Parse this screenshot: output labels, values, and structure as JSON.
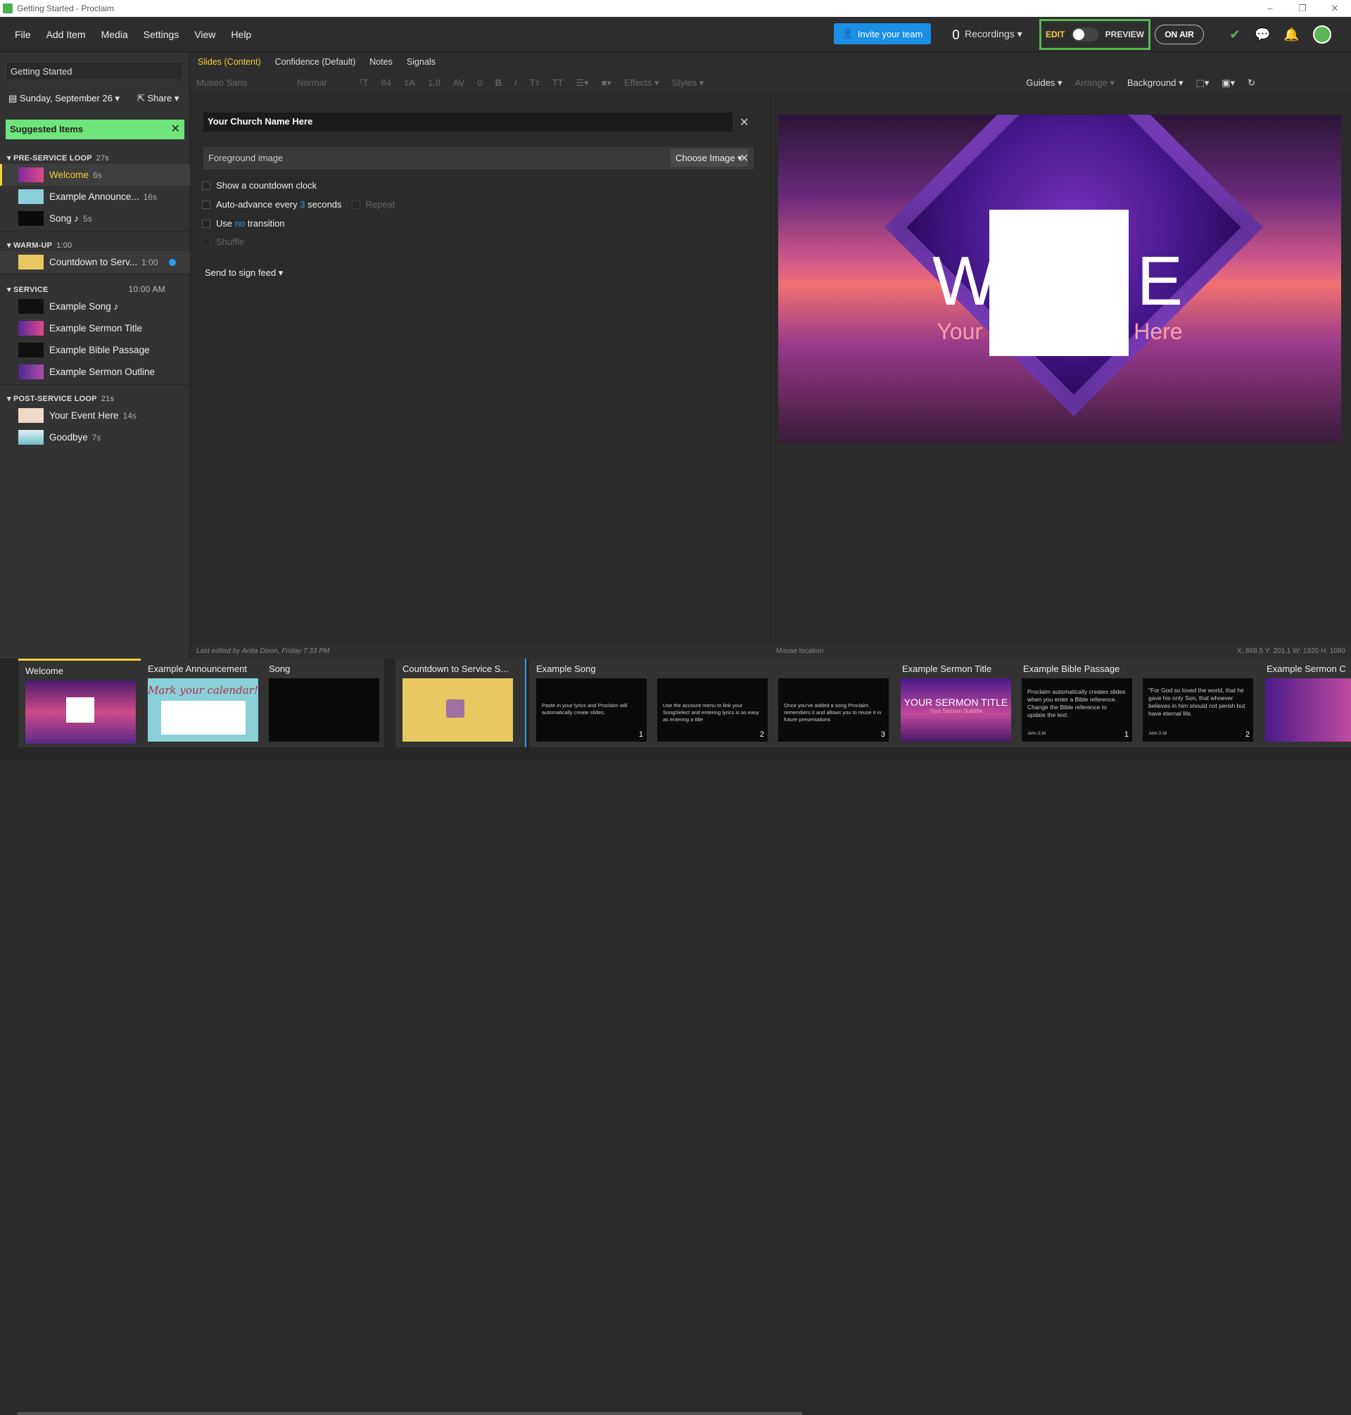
{
  "window": {
    "title": "Getting Started - Proclaim",
    "controls": [
      "–",
      "❐",
      "✕"
    ]
  },
  "menu": [
    "File",
    "Add Item",
    "Media",
    "Settings",
    "View",
    "Help"
  ],
  "topbar": {
    "invite": "Invite your team",
    "recordings": "Recordings ▾",
    "edit": "EDIT",
    "preview": "PREVIEW",
    "on_air": "ON AIR",
    "accent": "#5ab552"
  },
  "sidebar": {
    "title": "Getting Started",
    "date": "Sunday, September 26 ▾",
    "share": "Share ▾",
    "suggested": "Suggested Items",
    "sections": {
      "pre": {
        "name": "PRE-SERVICE LOOP",
        "time": "27s"
      },
      "warm": {
        "name": "WARM-UP",
        "time": "1:00"
      },
      "service": {
        "name": "SERVICE",
        "time": "10:00 AM"
      },
      "post": {
        "name": "POST-SERVICE LOOP",
        "time": "21s"
      }
    },
    "items": [
      {
        "label": "Welcome",
        "dur": "6s"
      },
      {
        "label": "Example Announce...",
        "dur": "16s"
      },
      {
        "label": "Song ♪",
        "dur": "5s"
      },
      {
        "label": "Countdown to Serv...",
        "dur": "1:00"
      },
      {
        "label": "Example Song ♪",
        "dur": ""
      },
      {
        "label": "Example Sermon Title",
        "dur": ""
      },
      {
        "label": "Example Bible Passage",
        "dur": ""
      },
      {
        "label": "Example Sermon Outline",
        "dur": ""
      },
      {
        "label": "Your Event Here",
        "dur": "14s"
      },
      {
        "label": "Goodbye",
        "dur": "7s"
      }
    ]
  },
  "tabs": [
    "Slides (Content)",
    "Confidence (Default)",
    "Notes",
    "Signals"
  ],
  "format": {
    "font": "Museo Sans",
    "weight": "Normal",
    "size": "84",
    "line": "1.0",
    "spacing": "0",
    "effects": "Effects ▾",
    "styles": "Styles ▾",
    "guides": "Guides ▾",
    "arrange": "Arrange ▾",
    "background": "Background ▾"
  },
  "editor": {
    "church_field": "Your Church Name Here",
    "fg_label": "Foreground image",
    "choose": "Choose Image ▾",
    "countdown": "Show a countdown clock",
    "auto_pre": "Auto-advance every",
    "auto_num": "3",
    "auto_post": "seconds",
    "repeat": "Repeat",
    "use": "Use",
    "no": "no",
    "transition": "transition",
    "shuffle": "Shuffle",
    "send": "Send to sign feed ▾"
  },
  "slide": {
    "title": "WE        ME",
    "subtitle": "Your Church Name Here"
  },
  "status": {
    "edited": "Last edited by Anita Dixon, Friday 7:33 PM",
    "mouse": "Mouse location",
    "coords": "X: 869.5  Y: 201.1   W: 1920  H: 1080"
  },
  "filmstrip": [
    {
      "label": "Welcome"
    },
    {
      "label": "Example Announcement"
    },
    {
      "label": "Song"
    },
    {
      "label": "Countdown to Service S..."
    },
    {
      "label": "Example Song"
    },
    {
      "label": "Example Sermon Title"
    },
    {
      "label": "Example Bible Passage"
    },
    {
      "label": "Example Sermon C"
    }
  ],
  "thumbs": {
    "song1": "Paste in your lyrics and Proclaim will automatically create slides.",
    "song2": "Use the account menu to link your SongSelect and entering lyrics is as easy as entering a title",
    "song3": "Once you've added a song Proclaim remembers it and allows you to reuse it in future presentations",
    "sermon": "YOUR SERMON TITLE",
    "sermon_sub": "Your Sermon Subtitle",
    "announce": "Mark your calendar!",
    "bible1": "Proclaim automatically creates slides when you enter a Bible reference. Change the Bible reference to update the text.",
    "bible2": "\"For God so loved the world, that he gave his only Son, that whoever believes in him should not perish but have eternal life.",
    "john": "John 3:16"
  }
}
